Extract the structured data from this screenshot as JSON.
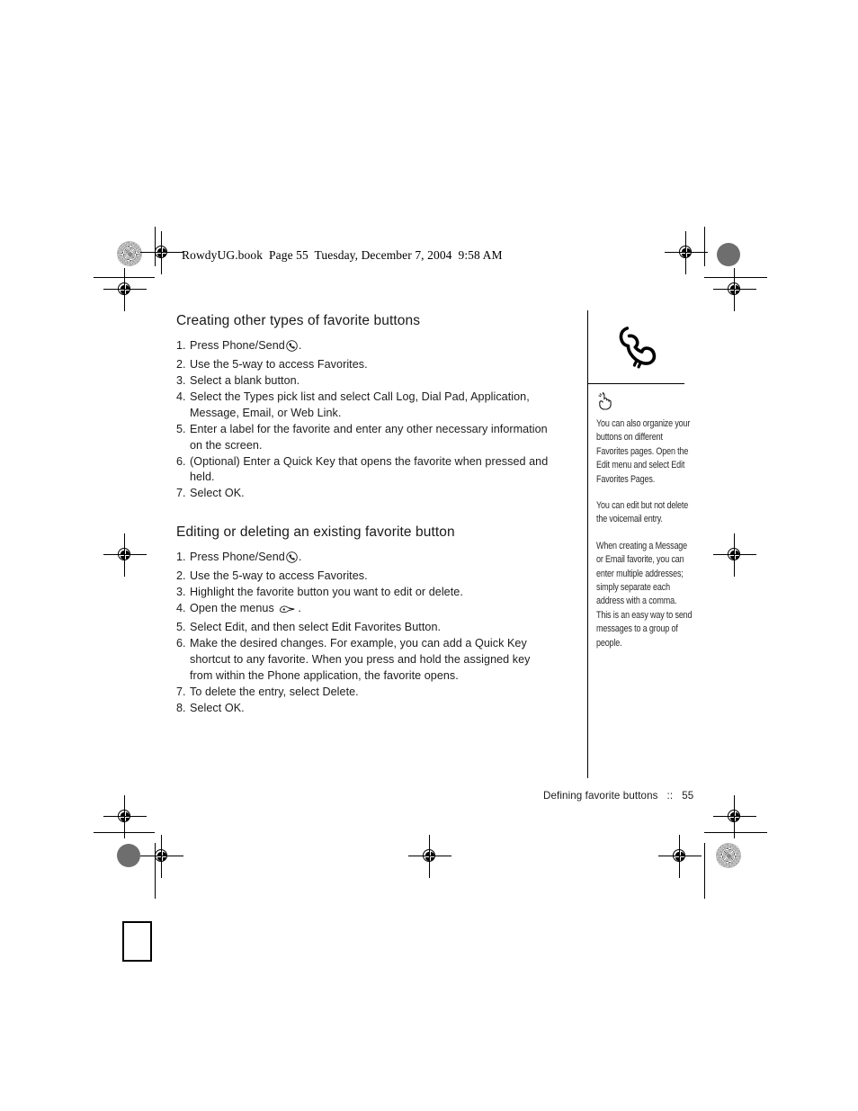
{
  "page": {
    "header_text": "RowdyUG.book  Page 55  Tuesday, December 7, 2004  9:58 AM",
    "footer_chapter": "Defining favorite buttons",
    "footer_separator": "::",
    "footer_page_number": "55"
  },
  "sections": [
    {
      "title": "Creating other types of favorite buttons",
      "steps": [
        {
          "num": "1.",
          "text_before": "Press Phone/Send",
          "icon": "phone-send-icon",
          "text_after": "."
        },
        {
          "num": "2.",
          "text_before": "Use the 5-way to access Favorites.",
          "icon": "",
          "text_after": ""
        },
        {
          "num": "3.",
          "text_before": "Select a blank button.",
          "icon": "",
          "text_after": ""
        },
        {
          "num": "4.",
          "text_before": "Select the Types pick list and select Call Log, Dial Pad, Application, Message, Email, or Web Link.",
          "icon": "",
          "text_after": ""
        },
        {
          "num": "5.",
          "text_before": "Enter a label for the favorite and enter any other necessary information on the  screen.",
          "icon": "",
          "text_after": ""
        },
        {
          "num": "6.",
          "text_before": "(Optional) Enter a Quick Key that opens the favorite when pressed and held.",
          "icon": "",
          "text_after": ""
        },
        {
          "num": "7.",
          "text_before": "Select OK.",
          "icon": "",
          "text_after": ""
        }
      ]
    },
    {
      "title": "Editing or deleting an existing favorite button",
      "steps": [
        {
          "num": "1.",
          "text_before": "Press Phone/Send",
          "icon": "phone-send-icon",
          "text_after": "."
        },
        {
          "num": "2.",
          "text_before": "Use the 5-way to access Favorites.",
          "icon": "",
          "text_after": ""
        },
        {
          "num": "3.",
          "text_before": "Highlight the favorite button you want to edit or delete.",
          "icon": "",
          "text_after": ""
        },
        {
          "num": "4.",
          "text_before": "Open the menus",
          "icon": "menu-key-icon",
          "text_after": "."
        },
        {
          "num": "5.",
          "text_before": "Select Edit, and then select Edit Favorites Button.",
          "icon": "",
          "text_after": ""
        },
        {
          "num": "6.",
          "text_before": "Make the desired changes. For example, you can add a Quick Key shortcut to any  favorite. When you press and hold the assigned key from within the Phone application, the favorite opens.",
          "icon": "",
          "text_after": ""
        },
        {
          "num": "7.",
          "text_before": "To delete the entry, select Delete.",
          "icon": "",
          "text_after": ""
        },
        {
          "num": "8.",
          "text_before": "Select OK.",
          "icon": "",
          "text_after": ""
        }
      ]
    }
  ],
  "sidebar": {
    "chapter_icon": "telephone-handset-icon",
    "tip_icon": "pointing-hand-icon",
    "tips": [
      "You can also organize your buttons on different Favorites pages. Open the Edit menu and select Edit Favorites Pages.",
      "You can edit but not delete the voicemail entry.",
      "When creating a Message or Email favorite, you can enter multiple addresses; simply separate each address with a comma. This is an easy way to send messages to a group of people."
    ]
  }
}
